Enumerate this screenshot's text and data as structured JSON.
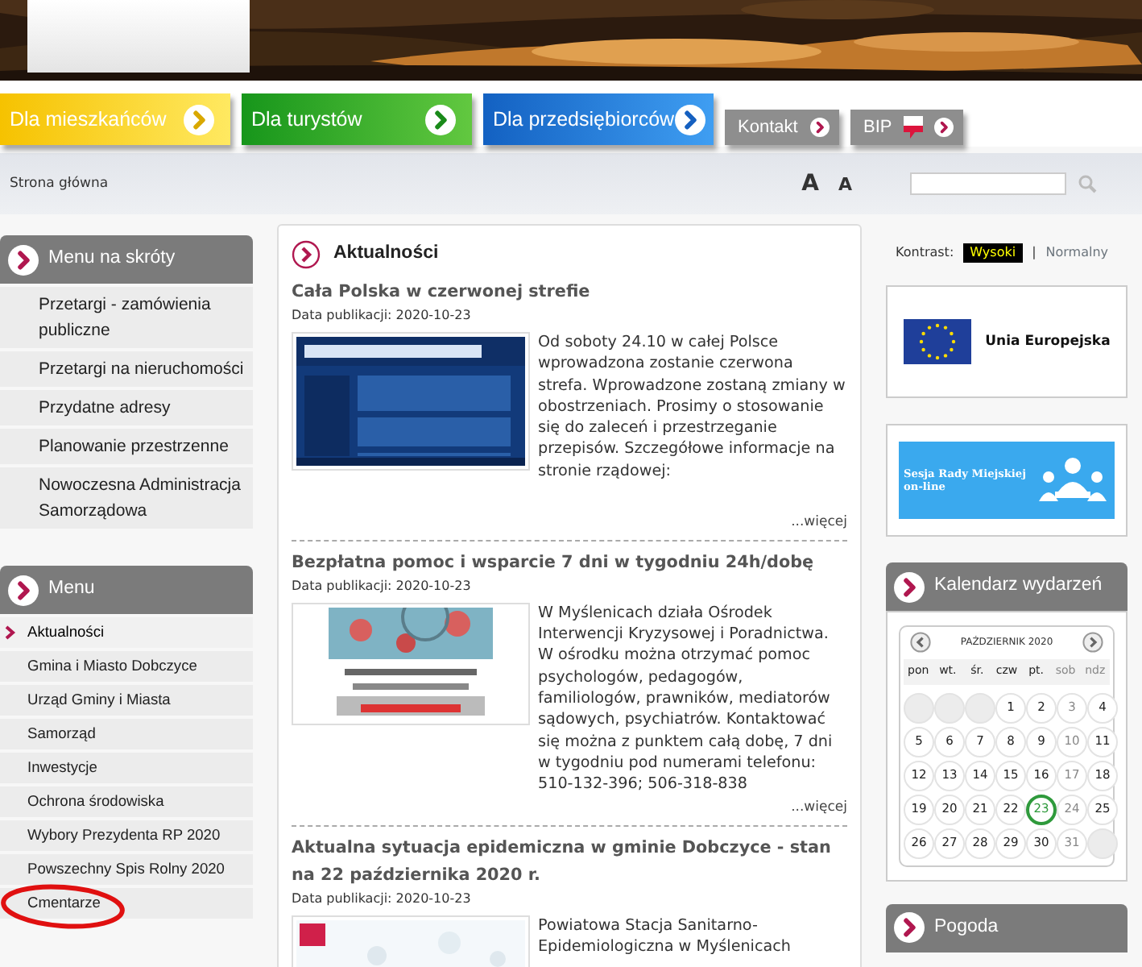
{
  "nav": [
    {
      "label": "Dla mieszkańców",
      "kind": "yellow"
    },
    {
      "label": "Dla turystów",
      "kind": "green"
    },
    {
      "label": "Dla przedsiębiorców",
      "kind": "blue"
    },
    {
      "label": "Kontakt",
      "kind": "grey"
    },
    {
      "label": "BIP",
      "kind": "bip"
    }
  ],
  "breadcrumb": "Strona główna",
  "font_buttons": [
    "A",
    "A"
  ],
  "left_panels": [
    {
      "title": "Menu na skróty",
      "kind": "shortcuts",
      "items": [
        {
          "label": "Przetargi - zamówienia publiczne"
        },
        {
          "label": "Przetargi na nieruchomości"
        },
        {
          "label": "Przydatne adresy"
        },
        {
          "label": "Planowanie przestrzenne"
        },
        {
          "label": "Nowoczesna Administracja Samorządowa"
        }
      ]
    },
    {
      "title": "Menu",
      "kind": "menu",
      "items": [
        {
          "label": "Aktualności",
          "selected": true
        },
        {
          "label": "Gmina i Miasto Dobczyce",
          "selected": false
        },
        {
          "label": "Urząd Gminy i Miasta",
          "selected": false
        },
        {
          "label": "Samorząd",
          "selected": false
        },
        {
          "label": "Inwestycje",
          "selected": false
        },
        {
          "label": "Ochrona środowiska",
          "selected": false
        },
        {
          "label": "Wybory Prezydenta RP 2020",
          "selected": false
        },
        {
          "label": "Powszechny Spis Rolny 2020",
          "selected": false
        },
        {
          "label": "Cmentarze",
          "selected": false,
          "circled": true
        }
      ]
    }
  ],
  "news": {
    "title": "Aktualności",
    "articles": [
      {
        "title": "Cała Polska w czerwonej strefie",
        "date": "Data publikacji: 2020-10-23",
        "text": "Od soboty 24.10 w całej Polsce wprowadzona zostanie czerwona strefa. Wprowadzone zostaną zmiany w obostrzeniach. Prosimy o stosowanie się do zaleceń i przestrzeganie przepisów. Szczegółowe informacje na stronie rządowej:",
        "more": "...więcej"
      },
      {
        "title": "Bezpłatna pomoc i wsparcie 7 dni w tygodniu 24h/dobę",
        "date": "Data publikacji: 2020-10-23",
        "text": "W Myślenicach działa Ośrodek Interwencji Kryzysowej i Poradnictwa. W ośrodku można otrzymać pomoc psychologów, pedagogów, familiologów, prawników, mediatorów sądowych, psychiatrów. Kontaktować się można z punktem całą dobę, 7 dni w tygodniu pod numerami telefonu: 510-132-396; 506-318-838",
        "more": "...więcej"
      },
      {
        "title": "Aktualna sytuacja epidemiczna w gminie Dobczyce - stan na 22 października 2020 r.",
        "date": "Data publikacji: 2020-10-23",
        "text": "Powiatowa Stacja Sanitarno-Epidemiologiczna w Myślenicach"
      }
    ]
  },
  "contrast": {
    "label": "Kontrast:",
    "separator": "|",
    "options": [
      {
        "label": "Wysoki",
        "kind": "high"
      },
      {
        "label": "Normalny",
        "kind": "normal"
      }
    ]
  },
  "banners": [
    {
      "label": "Unia Europejska",
      "kind": "eu"
    },
    {
      "label": "Sesja Rady Miejskiej on-line",
      "kind": "session"
    }
  ],
  "calendar": {
    "title": "Kalendarz wydarzeń",
    "month": "PAŹDZIERNIK 2020",
    "weekdays": [
      {
        "label": "pon",
        "muted": false
      },
      {
        "label": "wt.",
        "muted": false
      },
      {
        "label": "śr.",
        "muted": false
      },
      {
        "label": "czw",
        "muted": false
      },
      {
        "label": "pt.",
        "muted": false
      },
      {
        "label": "sob",
        "muted": true
      },
      {
        "label": "ndz",
        "muted": true
      }
    ],
    "weeks": [
      [
        {
          "kind": "blank"
        },
        {
          "kind": "blank"
        },
        {
          "kind": "blank"
        },
        {
          "kind": "day",
          "day": "1",
          "muted": false,
          "selected": false
        },
        {
          "kind": "day",
          "day": "2",
          "muted": false,
          "selected": false
        },
        {
          "kind": "day",
          "day": "3",
          "muted": true,
          "selected": false
        },
        {
          "kind": "day",
          "day": "4",
          "muted": false,
          "selected": false
        }
      ],
      [
        {
          "kind": "day",
          "day": "5",
          "muted": false,
          "selected": false
        },
        {
          "kind": "day",
          "day": "6",
          "muted": false,
          "selected": false
        },
        {
          "kind": "day",
          "day": "7",
          "muted": false,
          "selected": false
        },
        {
          "kind": "day",
          "day": "8",
          "muted": false,
          "selected": false
        },
        {
          "kind": "day",
          "day": "9",
          "muted": false,
          "selected": false
        },
        {
          "kind": "day",
          "day": "10",
          "muted": true,
          "selected": false
        },
        {
          "kind": "day",
          "day": "11",
          "muted": false,
          "selected": false
        }
      ],
      [
        {
          "kind": "day",
          "day": "12",
          "muted": false,
          "selected": false
        },
        {
          "kind": "day",
          "day": "13",
          "muted": false,
          "selected": false
        },
        {
          "kind": "day",
          "day": "14",
          "muted": false,
          "selected": false
        },
        {
          "kind": "day",
          "day": "15",
          "muted": false,
          "selected": false
        },
        {
          "kind": "day",
          "day": "16",
          "muted": false,
          "selected": false
        },
        {
          "kind": "day",
          "day": "17",
          "muted": true,
          "selected": false
        },
        {
          "kind": "day",
          "day": "18",
          "muted": false,
          "selected": false
        }
      ],
      [
        {
          "kind": "day",
          "day": "19",
          "muted": false,
          "selected": false
        },
        {
          "kind": "day",
          "day": "20",
          "muted": false,
          "selected": false
        },
        {
          "kind": "day",
          "day": "21",
          "muted": false,
          "selected": false
        },
        {
          "kind": "day",
          "day": "22",
          "muted": false,
          "selected": false
        },
        {
          "kind": "day",
          "day": "23",
          "muted": false,
          "selected": true
        },
        {
          "kind": "day",
          "day": "24",
          "muted": true,
          "selected": false
        },
        {
          "kind": "day",
          "day": "25",
          "muted": false,
          "selected": false
        }
      ],
      [
        {
          "kind": "day",
          "day": "26",
          "muted": false,
          "selected": false
        },
        {
          "kind": "day",
          "day": "27",
          "muted": false,
          "selected": false
        },
        {
          "kind": "day",
          "day": "28",
          "muted": false,
          "selected": false
        },
        {
          "kind": "day",
          "day": "29",
          "muted": false,
          "selected": false
        },
        {
          "kind": "day",
          "day": "30",
          "muted": false,
          "selected": false
        },
        {
          "kind": "day",
          "day": "31",
          "muted": true,
          "selected": false
        },
        {
          "kind": "blank"
        }
      ]
    ]
  },
  "weather": {
    "title": "Pogoda"
  }
}
